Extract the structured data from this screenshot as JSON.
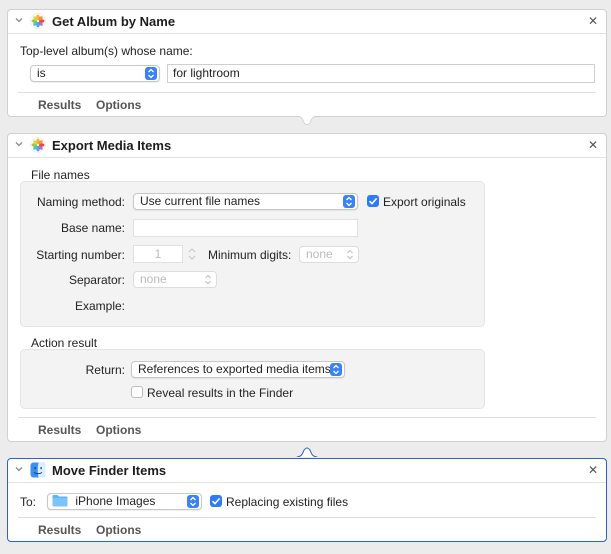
{
  "actions": [
    {
      "title": "Get Album by Name",
      "label": "Top-level album(s) whose name:",
      "operator": "is",
      "value": "for lightroom",
      "tabs": [
        "Results",
        "Options"
      ]
    },
    {
      "title": "Export Media Items",
      "file_names_section": "File names",
      "naming_method_label": "Naming method:",
      "naming_method_value": "Use current file names",
      "export_originals_label": "Export originals",
      "export_originals_checked": true,
      "base_name_label": "Base name:",
      "base_name_value": "",
      "starting_number_label": "Starting number:",
      "starting_number_value": "1",
      "minimum_digits_label": "Minimum digits:",
      "minimum_digits_value": "none",
      "separator_label": "Separator:",
      "separator_value": "none",
      "example_label": "Example:",
      "action_result_section": "Action result",
      "return_label": "Return:",
      "return_value": "References to exported media items",
      "reveal_label": "Reveal results in the Finder",
      "reveal_checked": false,
      "tabs": [
        "Results",
        "Options"
      ]
    },
    {
      "title": "Move Finder Items",
      "to_label": "To:",
      "to_value": "iPhone Images",
      "replacing_label": "Replacing existing files",
      "replacing_checked": true,
      "tabs": [
        "Results",
        "Options"
      ]
    }
  ],
  "colors": {
    "accent": "#2f7bf5",
    "selected_border": "#2a64c6"
  },
  "icons": {
    "photos": "photos-app-icon",
    "finder": "finder-app-icon",
    "close": "close-icon",
    "collapse": "chevron-down-icon",
    "folder": "folder-icon"
  }
}
